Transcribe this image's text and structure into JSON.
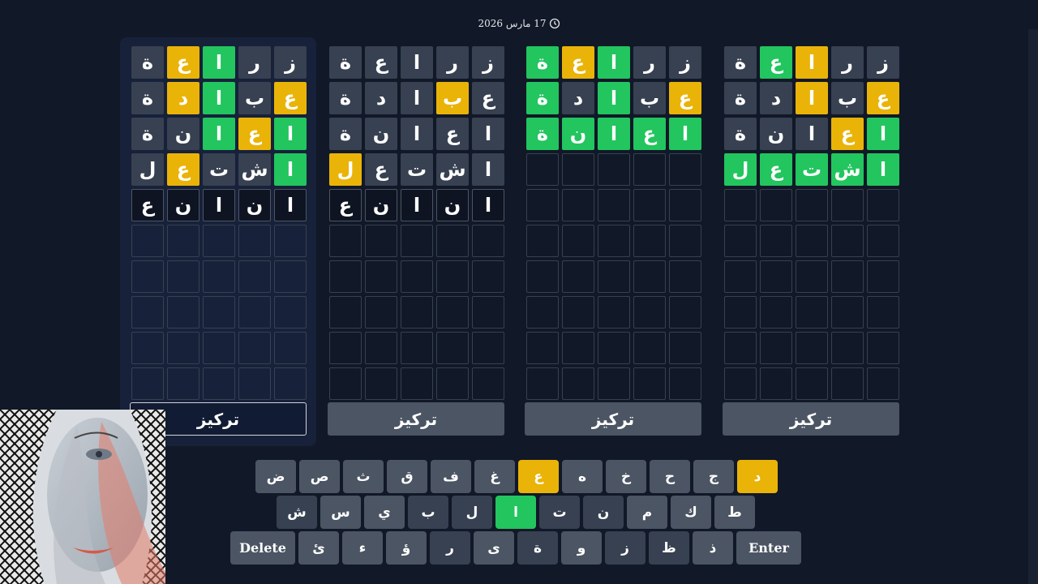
{
  "date": "17 مارس 2026",
  "focus_label": "تركيز",
  "colors": {
    "background": "#111827",
    "correct": "#22c55e",
    "present": "#eab308",
    "absent": "#374151",
    "key": "#4b5563"
  },
  "boards": [
    {
      "active": true,
      "rows": [
        [
          {
            "l": "ز",
            "s": "absent"
          },
          {
            "l": "ر",
            "s": "absent"
          },
          {
            "l": "ا",
            "s": "correct"
          },
          {
            "l": "ع",
            "s": "present"
          },
          {
            "l": "ة",
            "s": "absent"
          }
        ],
        [
          {
            "l": "ع",
            "s": "present"
          },
          {
            "l": "ب",
            "s": "absent"
          },
          {
            "l": "ا",
            "s": "correct"
          },
          {
            "l": "د",
            "s": "present"
          },
          {
            "l": "ة",
            "s": "absent"
          }
        ],
        [
          {
            "l": "ا",
            "s": "correct"
          },
          {
            "l": "ع",
            "s": "present"
          },
          {
            "l": "ا",
            "s": "correct"
          },
          {
            "l": "ن",
            "s": "absent"
          },
          {
            "l": "ة",
            "s": "absent"
          }
        ],
        [
          {
            "l": "ا",
            "s": "correct"
          },
          {
            "l": "ش",
            "s": "absent"
          },
          {
            "l": "ت",
            "s": "absent"
          },
          {
            "l": "ع",
            "s": "present"
          },
          {
            "l": "ل",
            "s": "absent"
          }
        ],
        [
          {
            "l": "ا",
            "s": "current"
          },
          {
            "l": "ن",
            "s": "current"
          },
          {
            "l": "ا",
            "s": "current"
          },
          {
            "l": "ن",
            "s": "current"
          },
          {
            "l": "ع",
            "s": "current"
          }
        ]
      ]
    },
    {
      "active": false,
      "rows": [
        [
          {
            "l": "ز",
            "s": "absent"
          },
          {
            "l": "ر",
            "s": "absent"
          },
          {
            "l": "ا",
            "s": "absent"
          },
          {
            "l": "ع",
            "s": "absent"
          },
          {
            "l": "ة",
            "s": "absent"
          }
        ],
        [
          {
            "l": "ع",
            "s": "absent"
          },
          {
            "l": "ب",
            "s": "present"
          },
          {
            "l": "ا",
            "s": "absent"
          },
          {
            "l": "د",
            "s": "absent"
          },
          {
            "l": "ة",
            "s": "absent"
          }
        ],
        [
          {
            "l": "ا",
            "s": "absent"
          },
          {
            "l": "ع",
            "s": "absent"
          },
          {
            "l": "ا",
            "s": "absent"
          },
          {
            "l": "ن",
            "s": "absent"
          },
          {
            "l": "ة",
            "s": "absent"
          }
        ],
        [
          {
            "l": "ا",
            "s": "absent"
          },
          {
            "l": "ش",
            "s": "absent"
          },
          {
            "l": "ت",
            "s": "absent"
          },
          {
            "l": "ع",
            "s": "absent"
          },
          {
            "l": "ل",
            "s": "present"
          }
        ],
        [
          {
            "l": "ا",
            "s": "current"
          },
          {
            "l": "ن",
            "s": "current"
          },
          {
            "l": "ا",
            "s": "current"
          },
          {
            "l": "ن",
            "s": "current"
          },
          {
            "l": "ع",
            "s": "current"
          }
        ]
      ]
    },
    {
      "active": false,
      "rows": [
        [
          {
            "l": "ز",
            "s": "absent"
          },
          {
            "l": "ر",
            "s": "absent"
          },
          {
            "l": "ا",
            "s": "correct"
          },
          {
            "l": "ع",
            "s": "present"
          },
          {
            "l": "ة",
            "s": "correct"
          }
        ],
        [
          {
            "l": "ع",
            "s": "present"
          },
          {
            "l": "ب",
            "s": "absent"
          },
          {
            "l": "ا",
            "s": "correct"
          },
          {
            "l": "د",
            "s": "absent"
          },
          {
            "l": "ة",
            "s": "correct"
          }
        ],
        [
          {
            "l": "ا",
            "s": "correct"
          },
          {
            "l": "ع",
            "s": "correct"
          },
          {
            "l": "ا",
            "s": "correct"
          },
          {
            "l": "ن",
            "s": "correct"
          },
          {
            "l": "ة",
            "s": "correct"
          }
        ]
      ]
    },
    {
      "active": false,
      "rows": [
        [
          {
            "l": "ز",
            "s": "absent"
          },
          {
            "l": "ر",
            "s": "absent"
          },
          {
            "l": "ا",
            "s": "present"
          },
          {
            "l": "ع",
            "s": "correct"
          },
          {
            "l": "ة",
            "s": "absent"
          }
        ],
        [
          {
            "l": "ع",
            "s": "present"
          },
          {
            "l": "ب",
            "s": "absent"
          },
          {
            "l": "ا",
            "s": "present"
          },
          {
            "l": "د",
            "s": "absent"
          },
          {
            "l": "ة",
            "s": "absent"
          }
        ],
        [
          {
            "l": "ا",
            "s": "correct"
          },
          {
            "l": "ع",
            "s": "present"
          },
          {
            "l": "ا",
            "s": "absent"
          },
          {
            "l": "ن",
            "s": "absent"
          },
          {
            "l": "ة",
            "s": "absent"
          }
        ],
        [
          {
            "l": "ا",
            "s": "correct"
          },
          {
            "l": "ش",
            "s": "correct"
          },
          {
            "l": "ت",
            "s": "correct"
          },
          {
            "l": "ع",
            "s": "correct"
          },
          {
            "l": "ل",
            "s": "correct"
          }
        ]
      ]
    }
  ],
  "keyboard": {
    "rows": [
      [
        {
          "k": "د",
          "s": "present"
        },
        {
          "k": "ج",
          "s": "normal"
        },
        {
          "k": "ح",
          "s": "normal"
        },
        {
          "k": "خ",
          "s": "normal"
        },
        {
          "k": "ه",
          "s": "normal"
        },
        {
          "k": "ع",
          "s": "present"
        },
        {
          "k": "غ",
          "s": "normal"
        },
        {
          "k": "ف",
          "s": "normal"
        },
        {
          "k": "ق",
          "s": "normal"
        },
        {
          "k": "ث",
          "s": "normal"
        },
        {
          "k": "ص",
          "s": "normal"
        },
        {
          "k": "ض",
          "s": "normal"
        }
      ],
      [
        {
          "k": "ط",
          "s": "normal"
        },
        {
          "k": "ك",
          "s": "normal"
        },
        {
          "k": "م",
          "s": "normal"
        },
        {
          "k": "ن",
          "s": "absent"
        },
        {
          "k": "ت",
          "s": "absent"
        },
        {
          "k": "ا",
          "s": "correct"
        },
        {
          "k": "ل",
          "s": "absent"
        },
        {
          "k": "ب",
          "s": "absent"
        },
        {
          "k": "ي",
          "s": "normal"
        },
        {
          "k": "س",
          "s": "normal"
        },
        {
          "k": "ش",
          "s": "absent"
        }
      ],
      [
        {
          "k": "Enter",
          "s": "wide"
        },
        {
          "k": "ذ",
          "s": "normal"
        },
        {
          "k": "ظ",
          "s": "absent"
        },
        {
          "k": "ز",
          "s": "absent"
        },
        {
          "k": "و",
          "s": "normal"
        },
        {
          "k": "ة",
          "s": "absent"
        },
        {
          "k": "ى",
          "s": "normal"
        },
        {
          "k": "ر",
          "s": "absent"
        },
        {
          "k": "ؤ",
          "s": "normal"
        },
        {
          "k": "ء",
          "s": "normal"
        },
        {
          "k": "ئ",
          "s": "normal"
        },
        {
          "k": "Delete",
          "s": "wide"
        }
      ]
    ]
  }
}
